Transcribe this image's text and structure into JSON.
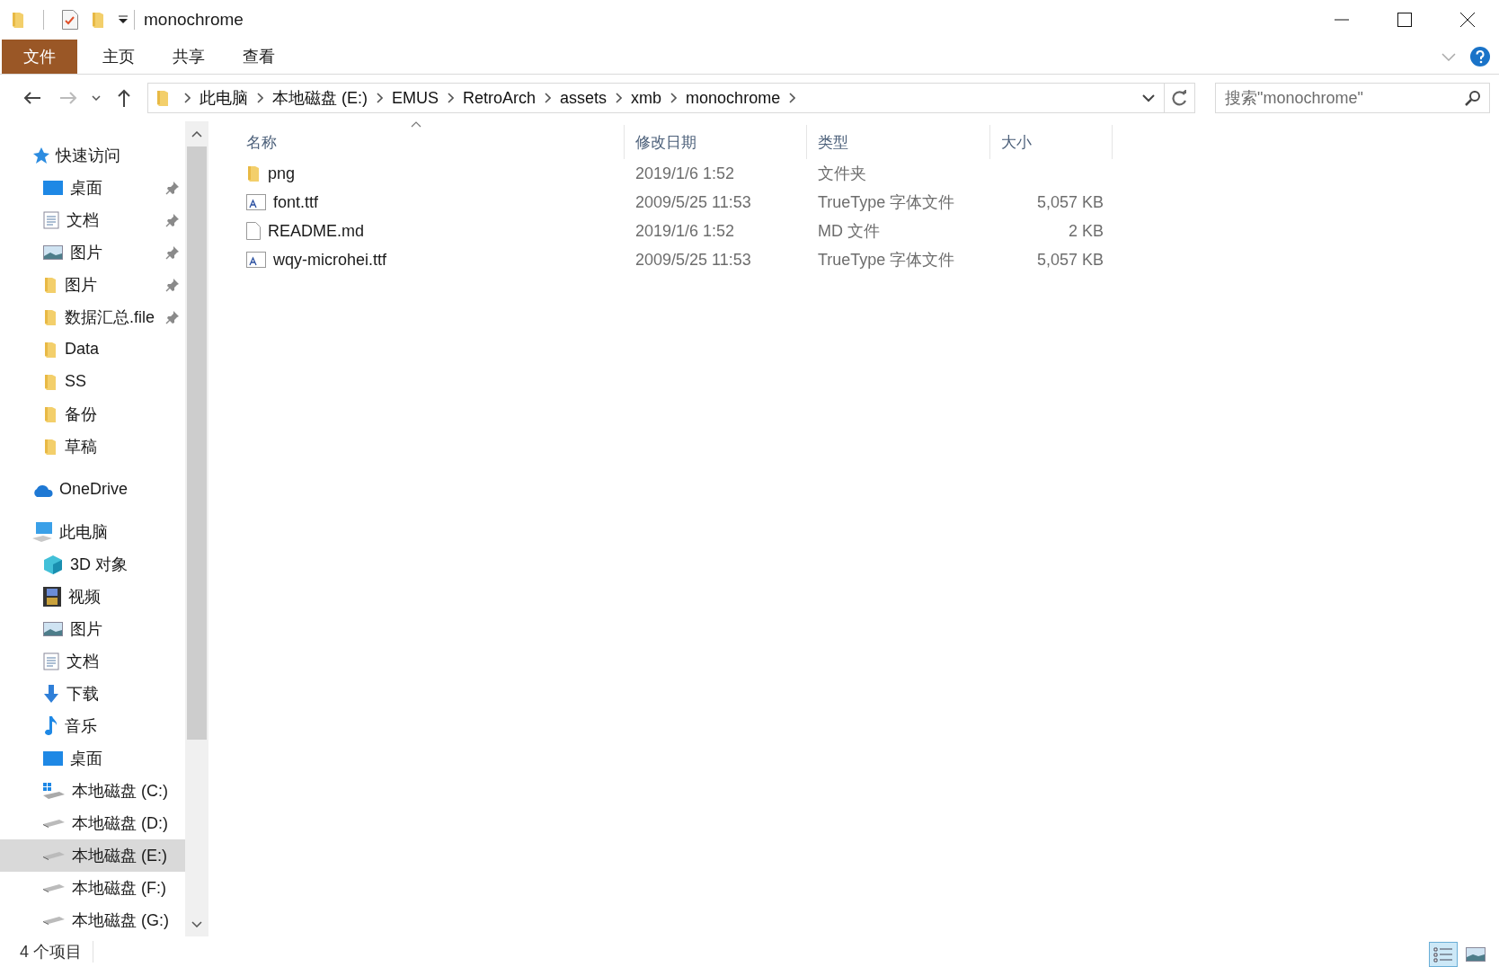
{
  "title_bar": {
    "title": "monochrome"
  },
  "ribbon": {
    "tabs": [
      {
        "label": "文件",
        "kind": "menu"
      },
      {
        "label": "主页",
        "kind": "tab"
      },
      {
        "label": "共享",
        "kind": "tab"
      },
      {
        "label": "查看",
        "kind": "tab"
      }
    ]
  },
  "address": {
    "crumbs": [
      "此电脑",
      "本地磁盘 (E:)",
      "EMUS",
      "RetroArch",
      "assets",
      "xmb",
      "monochrome"
    ]
  },
  "search": {
    "placeholder": "搜索\"monochrome\""
  },
  "sidebar": {
    "groups": [
      {
        "label": "快速访问",
        "kind": "star",
        "children": [
          {
            "label": "桌面",
            "kind": "desktop",
            "pinned": true,
            "selected": false
          },
          {
            "label": "文档",
            "kind": "document",
            "pinned": true,
            "selected": false
          },
          {
            "label": "图片",
            "kind": "picture",
            "pinned": true,
            "selected": false
          },
          {
            "label": "图片",
            "kind": "folder",
            "pinned": true,
            "selected": false
          },
          {
            "label": "数据汇总.file",
            "kind": "folder",
            "pinned": true,
            "selected": false
          },
          {
            "label": "Data",
            "kind": "folder",
            "pinned": false,
            "selected": false
          },
          {
            "label": "SS",
            "kind": "folder",
            "pinned": false,
            "selected": false
          },
          {
            "label": "备份",
            "kind": "folder",
            "pinned": false,
            "selected": false
          },
          {
            "label": "草稿",
            "kind": "folder",
            "pinned": false,
            "selected": false
          }
        ]
      },
      {
        "label": "OneDrive",
        "kind": "cloud"
      },
      {
        "label": "此电脑",
        "kind": "computer",
        "children": [
          {
            "label": "3D 对象",
            "kind": "cube",
            "pinned": false,
            "selected": false
          },
          {
            "label": "视频",
            "kind": "film",
            "pinned": false,
            "selected": false
          },
          {
            "label": "图片",
            "kind": "picture",
            "pinned": false,
            "selected": false
          },
          {
            "label": "文档",
            "kind": "document",
            "pinned": false,
            "selected": false
          },
          {
            "label": "下载",
            "kind": "download",
            "pinned": false,
            "selected": false
          },
          {
            "label": "音乐",
            "kind": "music",
            "pinned": false,
            "selected": false
          },
          {
            "label": "桌面",
            "kind": "desktop",
            "pinned": false,
            "selected": false
          },
          {
            "label": "本地磁盘 (C:)",
            "kind": "system-drive",
            "pinned": false,
            "selected": false
          },
          {
            "label": "本地磁盘 (D:)",
            "kind": "drive",
            "pinned": false,
            "selected": false
          },
          {
            "label": "本地磁盘 (E:)",
            "kind": "drive",
            "pinned": false,
            "selected": true
          },
          {
            "label": "本地磁盘 (F:)",
            "kind": "drive",
            "pinned": false,
            "selected": false
          },
          {
            "label": "本地磁盘 (G:)",
            "kind": "drive",
            "pinned": false,
            "selected": false
          }
        ]
      }
    ]
  },
  "table": {
    "columns": [
      {
        "label": "名称",
        "sorted": true
      },
      {
        "label": "修改日期",
        "sorted": false
      },
      {
        "label": "类型",
        "sorted": false
      },
      {
        "label": "大小",
        "sorted": false
      }
    ],
    "rows": [
      {
        "kind": "folder",
        "name": "png",
        "date": "2019/1/6 1:52",
        "type": "文件夹"
      },
      {
        "kind": "font",
        "name": "font.ttf",
        "date": "2009/5/25 11:53",
        "type": "TrueType 字体文件",
        "size": "5,057 KB"
      },
      {
        "kind": "file",
        "name": "README.md",
        "date": "2019/1/6 1:52",
        "type": "MD 文件",
        "size": "2 KB"
      },
      {
        "kind": "font",
        "name": "wqy-microhei.ttf",
        "date": "2009/5/25 11:53",
        "type": "TrueType 字体文件",
        "size": "5,057 KB"
      }
    ]
  },
  "status_bar": {
    "count": "4 个项目",
    "views": [
      {
        "kind": "details",
        "selected": true
      },
      {
        "kind": "large-icons",
        "selected": false
      }
    ]
  }
}
